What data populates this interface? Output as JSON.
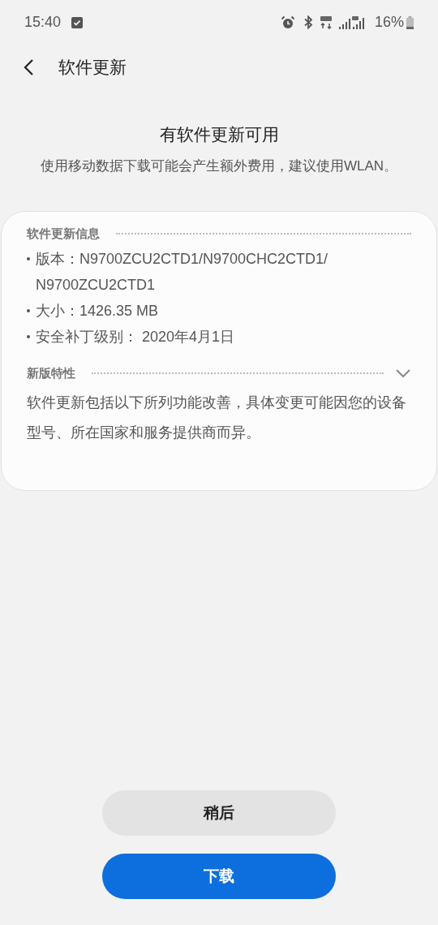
{
  "status_bar": {
    "time": "15:40",
    "battery": "16%"
  },
  "header": {
    "title": "软件更新"
  },
  "intro": {
    "title": "有软件更新可用",
    "subtitle": "使用移动数据下载可能会产生额外费用，建议使用WLAN。"
  },
  "info_section": {
    "heading": "软件更新信息",
    "items": [
      "版本：N9700ZCU2CTD1/N9700CHC2CTD1/N9700ZCU2CTD1",
      "大小：1426.35 MB",
      "安全补丁级别： 2020年4月1日"
    ]
  },
  "features_section": {
    "heading": "新版特性",
    "expanded": false,
    "description": "软件更新包括以下所列功能改善，具体变更可能因您的设备型号、所在国家和服务提供商而异。"
  },
  "buttons": [
    {
      "label": "稍后",
      "kind": "secondary"
    },
    {
      "label": "下载",
      "kind": "primary"
    }
  ]
}
